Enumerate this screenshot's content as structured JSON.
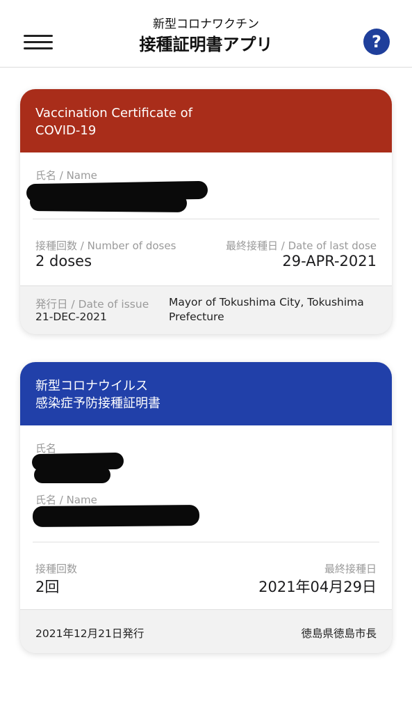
{
  "header": {
    "subtitle": "新型コロナワクチン",
    "title": "接種証明書アプリ",
    "menu_icon": "hamburger-menu-icon",
    "help_label": "?",
    "help_icon": "help-icon"
  },
  "colors": {
    "card1_header": "#a92d1a",
    "card2_header": "#2140a9",
    "help_button": "#1f3f9b"
  },
  "card1": {
    "title_line1": "Vaccination Certificate of",
    "title_line2": "COVID-19",
    "name_label": "氏名 / Name",
    "doses_label": "接種回数 / Number of doses",
    "doses_value": "2 doses",
    "last_dose_label": "最終接種日 / Date of last dose",
    "last_dose_value": "29-APR-2021",
    "issue_label": "発行日 / Date of issue",
    "issue_value": "21-DEC-2021",
    "issuer_line1": "Mayor of Tokushima City, Tokushima",
    "issuer_line2": "Prefecture"
  },
  "card2": {
    "title_line1": "新型コロナウイルス",
    "title_line2": "感染症予防接種証明書",
    "name_label_ja": "氏名",
    "name_label": "氏名 / Name",
    "doses_label": "接種回数",
    "doses_value": "2回",
    "last_dose_label": "最終接種日",
    "last_dose_value": "2021年04月29日",
    "issue_value": "2021年12月21日発行",
    "issuer": "徳島県徳島市長"
  }
}
